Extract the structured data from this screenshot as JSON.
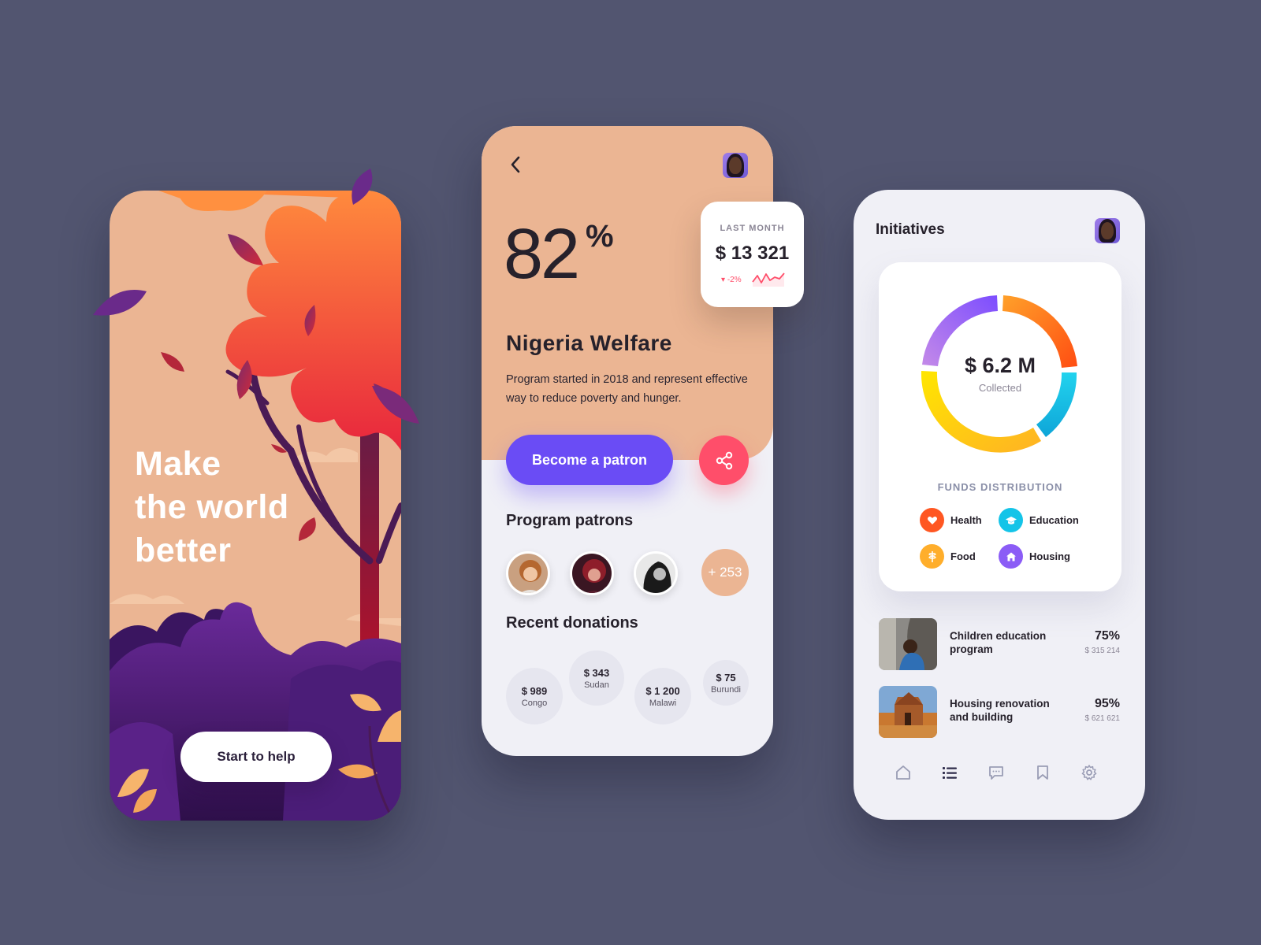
{
  "onboarding": {
    "headline": [
      "Make",
      "the world",
      "better"
    ],
    "cta_label": "Start to help"
  },
  "program": {
    "percent": "82",
    "percent_sign": "%",
    "title": "Nigeria Welfare",
    "description": "Program started in 2018 and represent effective way to reduce poverty and hunger.",
    "patron_button_label": "Become a patron",
    "patrons_title": "Program patrons",
    "patrons_more": "+ 253",
    "donations_title": "Recent donations",
    "donations": [
      {
        "amount": "$ 989",
        "country": "Congo"
      },
      {
        "amount": "$ 343",
        "country": "Sudan"
      },
      {
        "amount": "$ 1 200",
        "country": "Malawi"
      },
      {
        "amount": "$ 75",
        "country": "Burundi"
      }
    ],
    "last_month": {
      "label": "LAST MONTH",
      "value": "$ 13 321",
      "change": "-2%"
    }
  },
  "initiatives": {
    "title": "Initiatives",
    "total": "$ 6.2 M",
    "total_label": "Collected",
    "distribution_title": "FUNDS DISTRIBUTION",
    "legend": [
      {
        "label": "Health",
        "icon": "heart-icon",
        "color": "#FF5722"
      },
      {
        "label": "Education",
        "icon": "graduation-cap-icon",
        "color": "#14C4E8"
      },
      {
        "label": "Food",
        "icon": "wheat-icon",
        "color": "#FFAE2B"
      },
      {
        "label": "Housing",
        "icon": "house-icon",
        "color": "#8B5CF6"
      }
    ],
    "items": [
      {
        "name": "Children education program",
        "percent": "75%",
        "amount": "$ 315 214"
      },
      {
        "name": "Housing renovation and building",
        "percent": "95%",
        "amount": "$ 621 621"
      }
    ],
    "nav": [
      "home-icon",
      "list-icon",
      "chat-icon",
      "bookmark-icon",
      "settings-icon"
    ]
  },
  "colors": {
    "background": "#525570",
    "peach": "#EBB593",
    "primary": "#6A4CF5",
    "accent": "#FF4E6A"
  }
}
